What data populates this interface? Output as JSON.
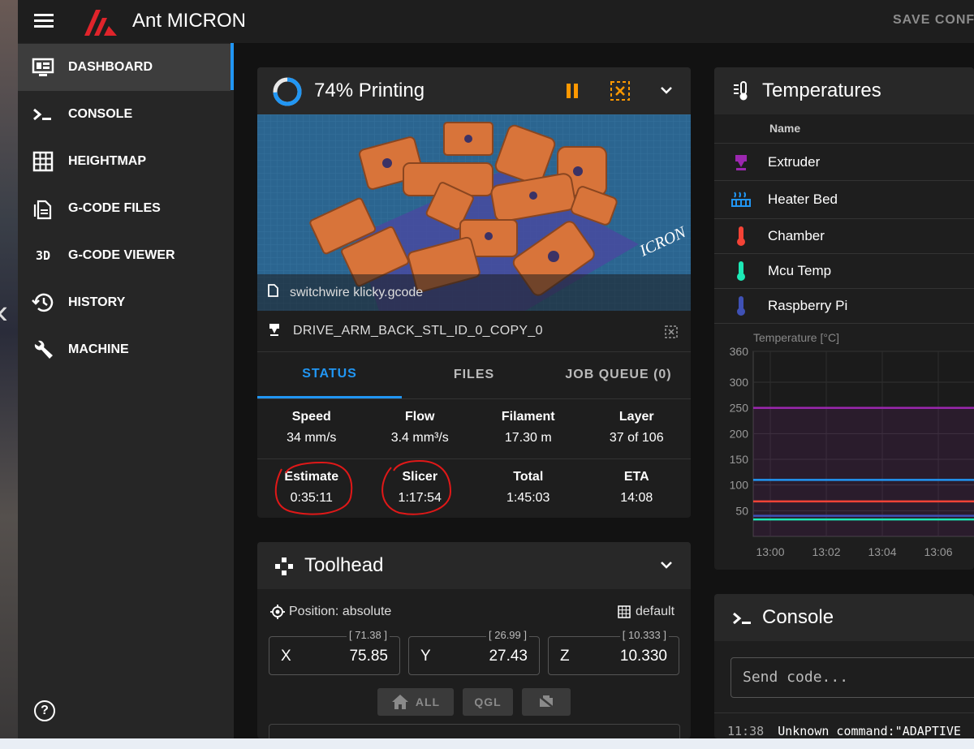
{
  "app": {
    "title": "Ant MICRON",
    "save_config": "SAVE CONF",
    "accent": "#2196f3",
    "brand_color": "#e0242b"
  },
  "nav": {
    "items": [
      {
        "label": "DASHBOARD",
        "icon": "monitor-dashboard-icon",
        "active": true
      },
      {
        "label": "CONSOLE",
        "icon": "console-prompt-icon",
        "active": false
      },
      {
        "label": "HEIGHTMAP",
        "icon": "grid-icon",
        "active": false
      },
      {
        "label": "G-CODE FILES",
        "icon": "file-document-icon",
        "active": false
      },
      {
        "label": "G-CODE VIEWER",
        "icon": "3d-icon",
        "active": false
      },
      {
        "label": "HISTORY",
        "icon": "history-icon",
        "active": false
      },
      {
        "label": "MACHINE",
        "icon": "wrench-icon",
        "active": false
      }
    ],
    "icon_3d_text": "3D"
  },
  "status": {
    "title": "74% Printing",
    "progress": 0.74,
    "filename": "switchwire klicky.gcode",
    "object": "DRIVE_ARM_BACK_STL_ID_0_COPY_0",
    "thumb_watermark": "ICRON",
    "tabs": [
      "STATUS",
      "FILES",
      "JOB QUEUE (0)"
    ],
    "stats_row1": [
      {
        "h": "Speed",
        "v": "34 mm/s"
      },
      {
        "h": "Flow",
        "v": "3.4 mm³/s"
      },
      {
        "h": "Filament",
        "v": "17.30 m"
      },
      {
        "h": "Layer",
        "v": "37 of 106"
      }
    ],
    "stats_row2": [
      {
        "h": "Estimate",
        "v": "0:35:11"
      },
      {
        "h": "Slicer",
        "v": "1:17:54"
      },
      {
        "h": "Total",
        "v": "1:45:03"
      },
      {
        "h": "ETA",
        "v": "14:08"
      }
    ],
    "pause_color": "#ff9800"
  },
  "toolhead": {
    "title": "Toolhead",
    "position_mode": "Position: absolute",
    "profile": "default",
    "axes": [
      {
        "name": "X",
        "value": "75.85",
        "requested": "[ 71.38 ]"
      },
      {
        "name": "Y",
        "value": "27.43",
        "requested": "[ 26.99 ]"
      },
      {
        "name": "Z",
        "value": "10.330",
        "requested": "[ 10.333 ]"
      }
    ],
    "buttons": [
      "ALL",
      "QGL"
    ]
  },
  "temperatures": {
    "title": "Temperatures",
    "column_name": "Name",
    "sensors": [
      {
        "name": "Extruder",
        "color": "#9c27b0"
      },
      {
        "name": "Heater Bed",
        "color": "#2196f3"
      },
      {
        "name": "Chamber",
        "color": "#f44336"
      },
      {
        "name": "Mcu Temp",
        "color": "#1de9b6"
      },
      {
        "name": "Raspberry Pi",
        "color": "#3f51b5"
      }
    ]
  },
  "chart_data": {
    "type": "line",
    "ylabel": "Temperature [°C]",
    "ylim": [
      0,
      360
    ],
    "yticks": [
      "360",
      "300",
      "250",
      "200",
      "150",
      "100",
      "50"
    ],
    "xticks": [
      "13:00",
      "13:02",
      "13:04",
      "13:06"
    ],
    "series": [
      {
        "name": "Extruder",
        "color": "#9c27b0",
        "values": [
          250,
          250,
          250,
          250,
          250
        ]
      },
      {
        "name": "Heater Bed",
        "color": "#2196f3",
        "values": [
          110,
          110,
          110,
          110,
          110
        ]
      },
      {
        "name": "Chamber",
        "color": "#f44336",
        "values": [
          68,
          68,
          68,
          68,
          68
        ]
      },
      {
        "name": "Mcu Temp",
        "color": "#1de9b6",
        "values": [
          33,
          33,
          33,
          33,
          33
        ]
      },
      {
        "name": "Raspberry Pi",
        "color": "#3f51b5",
        "values": [
          40,
          40,
          40,
          40,
          40
        ]
      }
    ]
  },
  "console": {
    "title": "Console",
    "placeholder": "Send code...",
    "log": [
      {
        "time": "11:38",
        "text": "Unknown command:\"ADAPTIVE"
      }
    ]
  }
}
